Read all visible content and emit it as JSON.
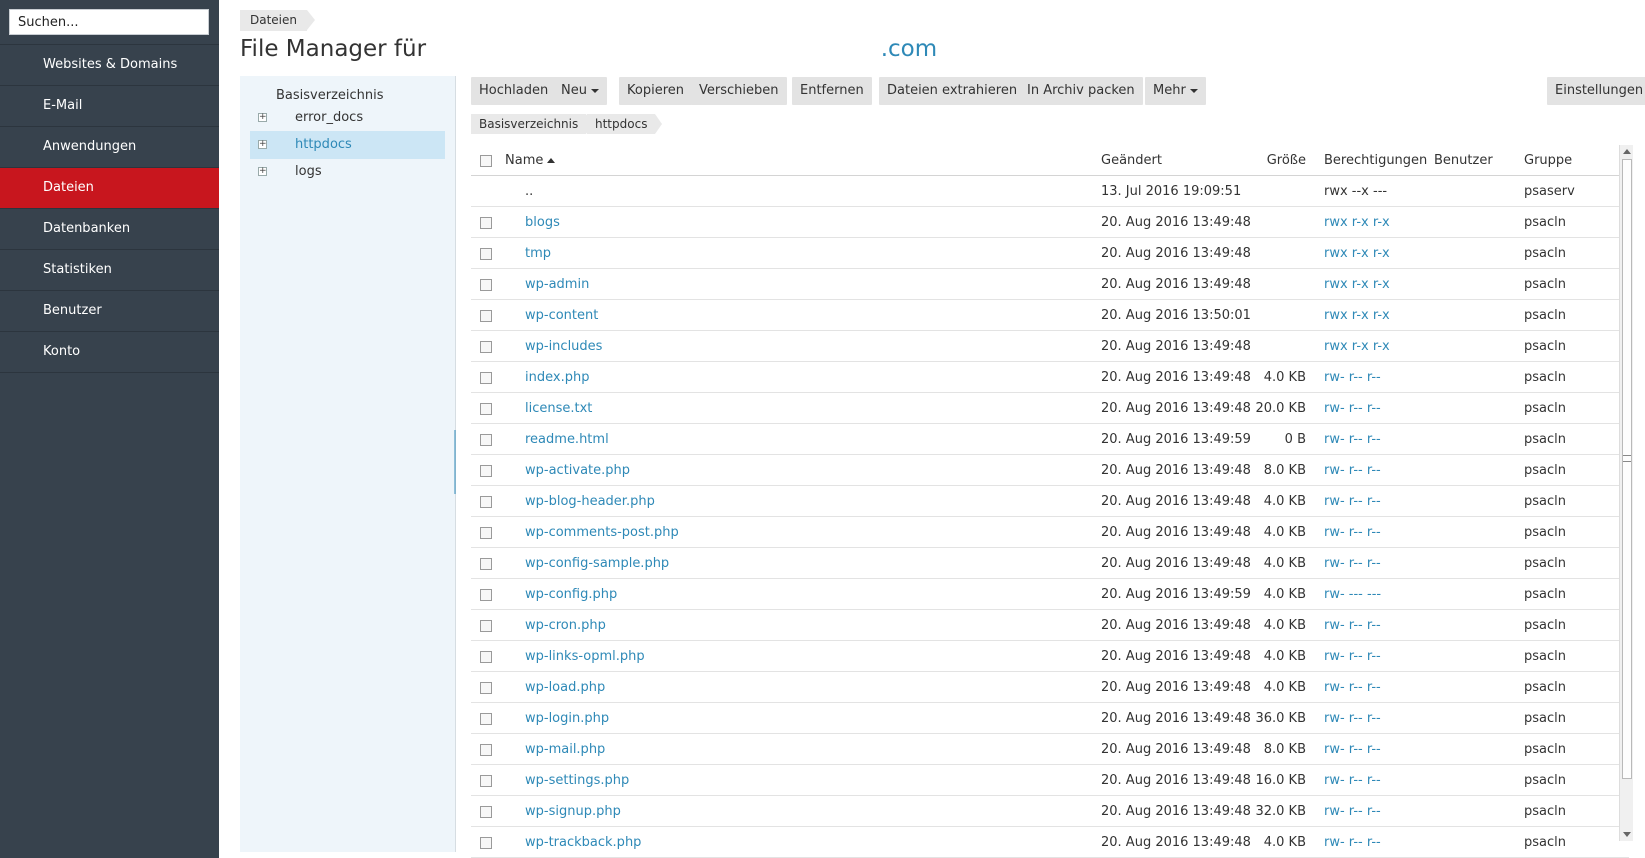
{
  "sidebar": {
    "search_placeholder": "Suchen...",
    "items": [
      {
        "label": "Websites & Domains",
        "name": "nav-websites-domains"
      },
      {
        "label": "E-Mail",
        "name": "nav-email"
      },
      {
        "label": "Anwendungen",
        "name": "nav-anwendungen"
      },
      {
        "label": "Dateien",
        "name": "nav-dateien"
      },
      {
        "label": "Datenbanken",
        "name": "nav-datenbanken"
      },
      {
        "label": "Statistiken",
        "name": "nav-statistiken"
      },
      {
        "label": "Benutzer",
        "name": "nav-benutzer"
      },
      {
        "label": "Konto",
        "name": "nav-konto"
      }
    ],
    "active_index": 3,
    "active_color": "#c8161e"
  },
  "header": {
    "breadcrumb": "Dateien",
    "title": "File Manager für",
    "title_domain": ".com"
  },
  "tree": {
    "root": "Basisverzeichnis",
    "nodes": [
      {
        "label": "error_docs",
        "expander": "+",
        "selected": false
      },
      {
        "label": "httpdocs",
        "expander": "+",
        "selected": true
      },
      {
        "label": "logs",
        "expander": "+",
        "selected": false
      }
    ]
  },
  "toolbar": {
    "upload": "Hochladen",
    "new": "Neu",
    "copy": "Kopieren",
    "move": "Verschieben",
    "remove": "Entfernen",
    "extract": "Dateien extrahieren",
    "archive": "In Archiv packen",
    "more": "Mehr",
    "settings": "Einstellungen"
  },
  "path": [
    "Basisverzeichnis",
    "httpdocs"
  ],
  "table": {
    "columns": {
      "name": "Name",
      "modified": "Geändert",
      "size": "Größe",
      "permissions": "Berechtigungen",
      "user": "Benutzer",
      "group": "Gruppe"
    },
    "rows": [
      {
        "name": "..",
        "modified": "13. Jul 2016 19:09:51",
        "size": "",
        "perm": "rwx --x ---",
        "user": "",
        "group": "psaserv"
      },
      {
        "name": "blogs",
        "modified": "20. Aug 2016 13:49:48",
        "size": "",
        "perm": "rwx r-x r-x",
        "user": "",
        "group": "psacln"
      },
      {
        "name": "tmp",
        "modified": "20. Aug 2016 13:49:48",
        "size": "",
        "perm": "rwx r-x r-x",
        "user": "",
        "group": "psacln"
      },
      {
        "name": "wp-admin",
        "modified": "20. Aug 2016 13:49:48",
        "size": "",
        "perm": "rwx r-x r-x",
        "user": "",
        "group": "psacln"
      },
      {
        "name": "wp-content",
        "modified": "20. Aug 2016 13:50:01",
        "size": "",
        "perm": "rwx r-x r-x",
        "user": "",
        "group": "psacln"
      },
      {
        "name": "wp-includes",
        "modified": "20. Aug 2016 13:49:48",
        "size": "",
        "perm": "rwx r-x r-x",
        "user": "",
        "group": "psacln"
      },
      {
        "name": "index.php",
        "modified": "20. Aug 2016 13:49:48",
        "size": "4.0 KB",
        "perm": "rw- r-- r--",
        "user": "",
        "group": "psacln"
      },
      {
        "name": "license.txt",
        "modified": "20. Aug 2016 13:49:48",
        "size": "20.0 KB",
        "perm": "rw- r-- r--",
        "user": "",
        "group": "psacln"
      },
      {
        "name": "readme.html",
        "modified": "20. Aug 2016 13:49:59",
        "size": "0 B",
        "perm": "rw- r-- r--",
        "user": "",
        "group": "psacln"
      },
      {
        "name": "wp-activate.php",
        "modified": "20. Aug 2016 13:49:48",
        "size": "8.0 KB",
        "perm": "rw- r-- r--",
        "user": "",
        "group": "psacln"
      },
      {
        "name": "wp-blog-header.php",
        "modified": "20. Aug 2016 13:49:48",
        "size": "4.0 KB",
        "perm": "rw- r-- r--",
        "user": "",
        "group": "psacln"
      },
      {
        "name": "wp-comments-post.php",
        "modified": "20. Aug 2016 13:49:48",
        "size": "4.0 KB",
        "perm": "rw- r-- r--",
        "user": "",
        "group": "psacln"
      },
      {
        "name": "wp-config-sample.php",
        "modified": "20. Aug 2016 13:49:48",
        "size": "4.0 KB",
        "perm": "rw- r-- r--",
        "user": "",
        "group": "psacln"
      },
      {
        "name": "wp-config.php",
        "modified": "20. Aug 2016 13:49:59",
        "size": "4.0 KB",
        "perm": "rw- --- ---",
        "user": "",
        "group": "psacln"
      },
      {
        "name": "wp-cron.php",
        "modified": "20. Aug 2016 13:49:48",
        "size": "4.0 KB",
        "perm": "rw- r-- r--",
        "user": "",
        "group": "psacln"
      },
      {
        "name": "wp-links-opml.php",
        "modified": "20. Aug 2016 13:49:48",
        "size": "4.0 KB",
        "perm": "rw- r-- r--",
        "user": "",
        "group": "psacln"
      },
      {
        "name": "wp-load.php",
        "modified": "20. Aug 2016 13:49:48",
        "size": "4.0 KB",
        "perm": "rw- r-- r--",
        "user": "",
        "group": "psacln"
      },
      {
        "name": "wp-login.php",
        "modified": "20. Aug 2016 13:49:48",
        "size": "36.0 KB",
        "perm": "rw- r-- r--",
        "user": "",
        "group": "psacln"
      },
      {
        "name": "wp-mail.php",
        "modified": "20. Aug 2016 13:49:48",
        "size": "8.0 KB",
        "perm": "rw- r-- r--",
        "user": "",
        "group": "psacln"
      },
      {
        "name": "wp-settings.php",
        "modified": "20. Aug 2016 13:49:48",
        "size": "16.0 KB",
        "perm": "rw- r-- r--",
        "user": "",
        "group": "psacln"
      },
      {
        "name": "wp-signup.php",
        "modified": "20. Aug 2016 13:49:48",
        "size": "32.0 KB",
        "perm": "rw- r-- r--",
        "user": "",
        "group": "psacln"
      },
      {
        "name": "wp-trackback.php",
        "modified": "20. Aug 2016 13:49:48",
        "size": "4.0 KB",
        "perm": "rw- r-- r--",
        "user": "",
        "group": "psacln"
      }
    ]
  },
  "colors": {
    "sidebar_bg": "#37424d",
    "link": "#2e89b7",
    "tree_bg": "#eef5fa",
    "tree_selected": "#cce6f5"
  }
}
